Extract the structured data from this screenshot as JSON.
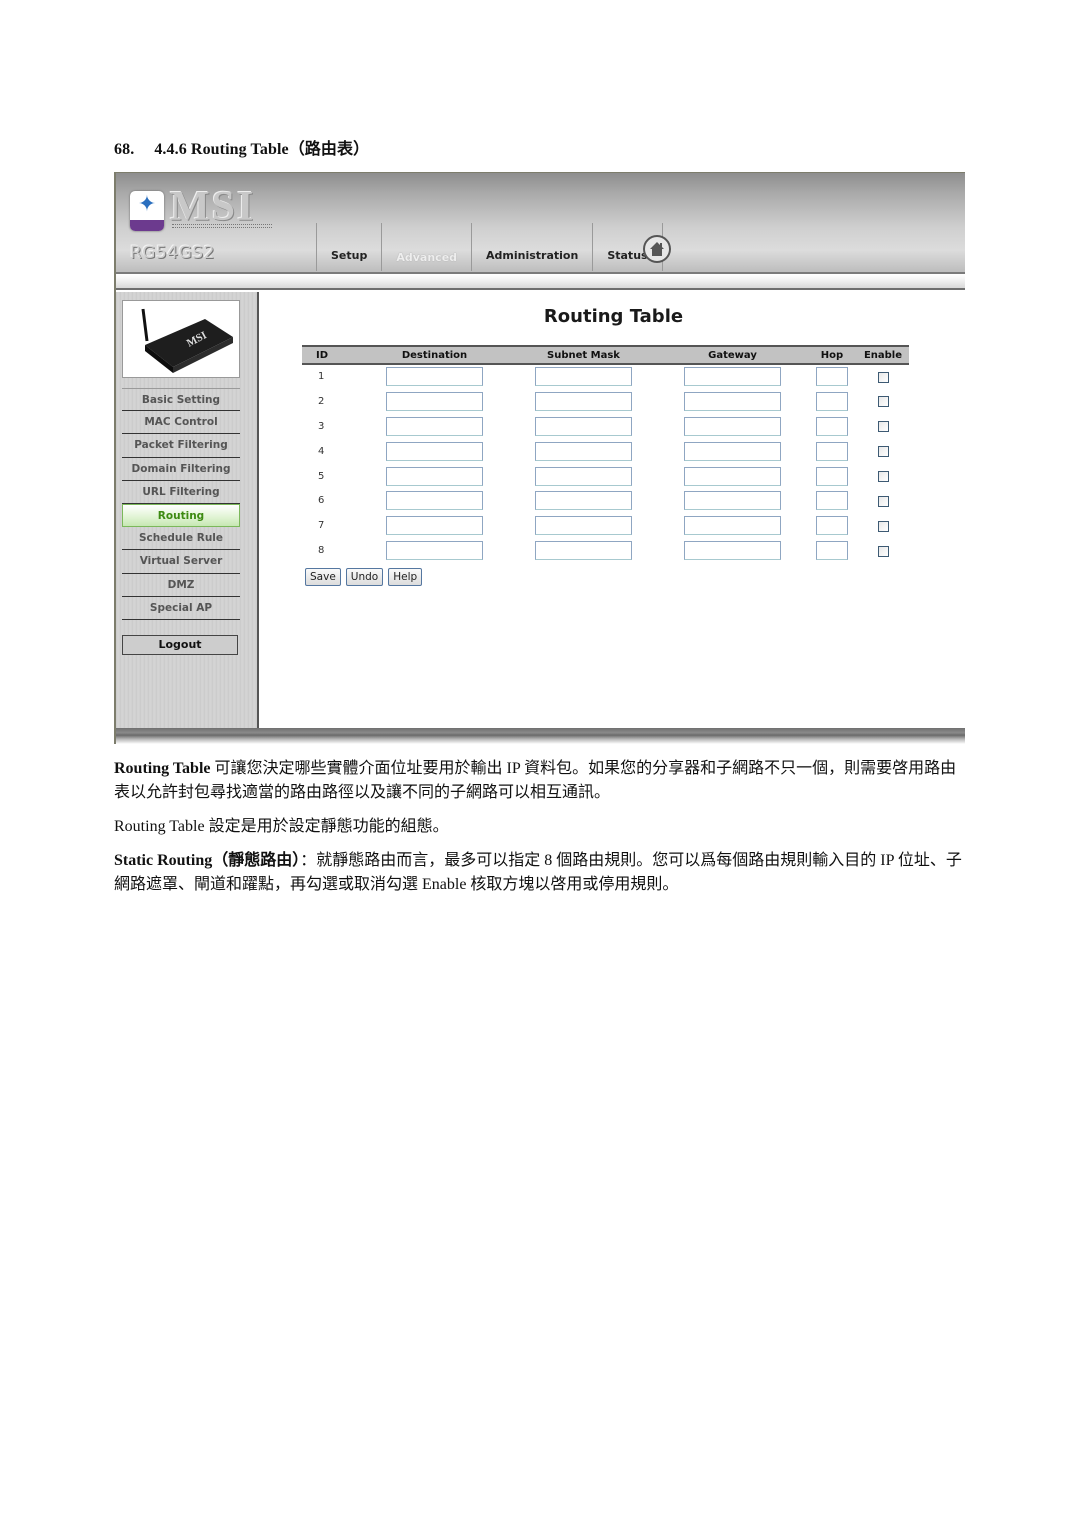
{
  "heading": {
    "number": "68.",
    "title": "4.4.6 Routing Table（路由表）"
  },
  "router_ui": {
    "brand": "MSI",
    "brand_icon": "msi-star-badge-icon",
    "model": "RG54GS2",
    "tabs": [
      {
        "label": "Setup",
        "active": false
      },
      {
        "label": "Advanced",
        "active": true
      },
      {
        "label": "Administration",
        "active": false
      },
      {
        "label": "Status",
        "active": false
      }
    ],
    "home_icon": "home-icon",
    "sidebar": {
      "image": "router-device-image",
      "items": [
        {
          "label": "Basic Setting",
          "active": false
        },
        {
          "label": "MAC Control",
          "active": false
        },
        {
          "label": "Packet Filtering",
          "active": false
        },
        {
          "label": "Domain Filtering",
          "active": false
        },
        {
          "label": "URL Filtering",
          "active": false
        },
        {
          "label": "Routing",
          "active": true
        },
        {
          "label": "Schedule Rule",
          "active": false
        },
        {
          "label": "Virtual Server",
          "active": false
        },
        {
          "label": "DMZ",
          "active": false
        },
        {
          "label": "Special AP",
          "active": false
        }
      ],
      "logout_label": "Logout"
    },
    "page_title": "Routing Table",
    "table": {
      "columns": [
        "ID",
        "Destination",
        "Subnet Mask",
        "Gateway",
        "Hop",
        "Enable"
      ],
      "rows": [
        {
          "id": "1",
          "destination": "",
          "subnet_mask": "",
          "gateway": "",
          "hop": "",
          "enabled": false
        },
        {
          "id": "2",
          "destination": "",
          "subnet_mask": "",
          "gateway": "",
          "hop": "",
          "enabled": false
        },
        {
          "id": "3",
          "destination": "",
          "subnet_mask": "",
          "gateway": "",
          "hop": "",
          "enabled": false
        },
        {
          "id": "4",
          "destination": "",
          "subnet_mask": "",
          "gateway": "",
          "hop": "",
          "enabled": false
        },
        {
          "id": "5",
          "destination": "",
          "subnet_mask": "",
          "gateway": "",
          "hop": "",
          "enabled": false
        },
        {
          "id": "6",
          "destination": "",
          "subnet_mask": "",
          "gateway": "",
          "hop": "",
          "enabled": false
        },
        {
          "id": "7",
          "destination": "",
          "subnet_mask": "",
          "gateway": "",
          "hop": "",
          "enabled": false
        },
        {
          "id": "8",
          "destination": "",
          "subnet_mask": "",
          "gateway": "",
          "hop": "",
          "enabled": false
        }
      ]
    },
    "buttons": {
      "save": "Save",
      "undo": "Undo",
      "help": "Help"
    },
    "colors": {
      "active_nav_text": "#3d8a12",
      "table_header_bg": "#c2c2c2",
      "input_border": "#8fa6c2"
    }
  },
  "paragraphs": {
    "p1_bold": "Routing  Table",
    "p1_text": " 可讓您決定哪些實體介面位址要用於輸出 IP 資料包。如果您的分享器和子網路不只一個，則需要啓用路由表以允許封包尋找適當的路由路徑以及讓不同的子網路可以相互通訊。",
    "p2_text": "Routing Table 設定是用於設定靜態功能的組態。",
    "p3_bold": "Static  Routing（靜態路由）",
    "p3_text": "：就靜態路由而言，最多可以指定 8 個路由規則。您可以爲每個路由規則輸入目的 IP 位址、子網路遮罩、閘道和躍點，再勾選或取消勾選 Enable 核取方塊以啓用或停用規則。"
  }
}
